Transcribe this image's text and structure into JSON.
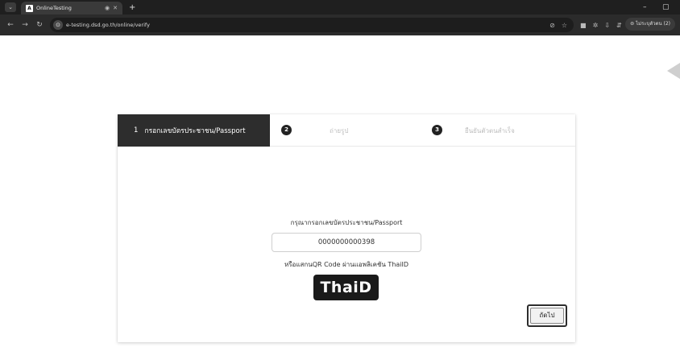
{
  "browser": {
    "tab_title": "OnlineTesting",
    "favicon_letter": "A",
    "new_tab": "+",
    "url": "e-testing.dsd.go.th/online/verify",
    "profile": "ไม่ระบุตัวตน (2)"
  },
  "steps": {
    "step1_num": "1",
    "step1_label": "กรอกเลขบัตรประชาชน/Passport",
    "step2_num": "2",
    "step2_label": "ถ่ายรูป",
    "step3_num": "3",
    "step3_label": "ยืนยันตัวตนสำเร็จ"
  },
  "form": {
    "prompt": "กรุณากรอกเลขบัตรประชาชน/Passport",
    "id_value": "0000000000398",
    "qr_text": "หรือแสกนQR Code ผ่านแอพลิเคชัน ThaiID",
    "logo_text": "ThaiD",
    "next_label": "ถัดไป"
  },
  "colors": {
    "active_step_bg": "#2d2d2d",
    "inactive_step_text": "#bdbdbd"
  }
}
